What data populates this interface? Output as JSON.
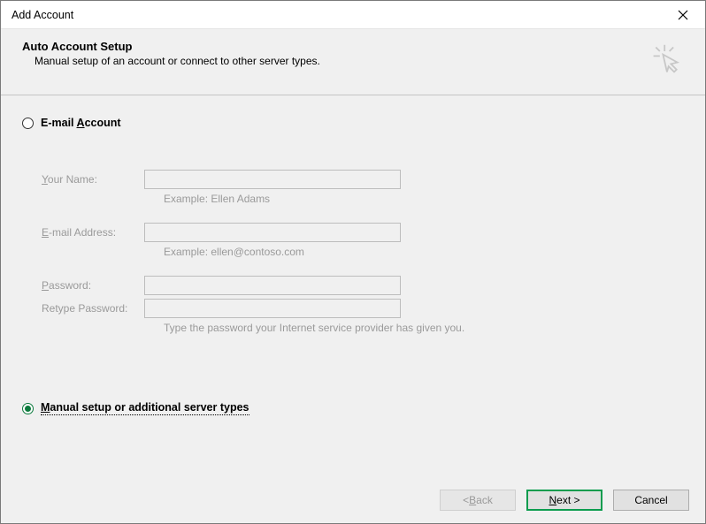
{
  "window": {
    "title": "Add Account"
  },
  "header": {
    "title": "Auto Account Setup",
    "subtitle": "Manual setup of an account or connect to other server types."
  },
  "radios": {
    "email_prefix": "E-mail ",
    "email_underline": "A",
    "email_suffix": "ccount",
    "manual_underline": "M",
    "manual_suffix": "anual setup or additional server types"
  },
  "form": {
    "yourname_underline": "Y",
    "yourname_suffix": "our Name:",
    "yourname_value": "",
    "yourname_hint": "Example: Ellen Adams",
    "email_underline": "E",
    "email_suffix": "-mail Address:",
    "email_value": "",
    "email_hint": "Example: ellen@contoso.com",
    "password_underline": "P",
    "password_suffix": "assword:",
    "password_value": "",
    "retype_label": "Retype Password:",
    "retype_value": "",
    "password_hint": "Type the password your Internet service provider has given you."
  },
  "buttons": {
    "back_prefix": "< ",
    "back_underline": "B",
    "back_suffix": "ack",
    "next_underline": "N",
    "next_suffix": "ext >",
    "cancel": "Cancel"
  }
}
